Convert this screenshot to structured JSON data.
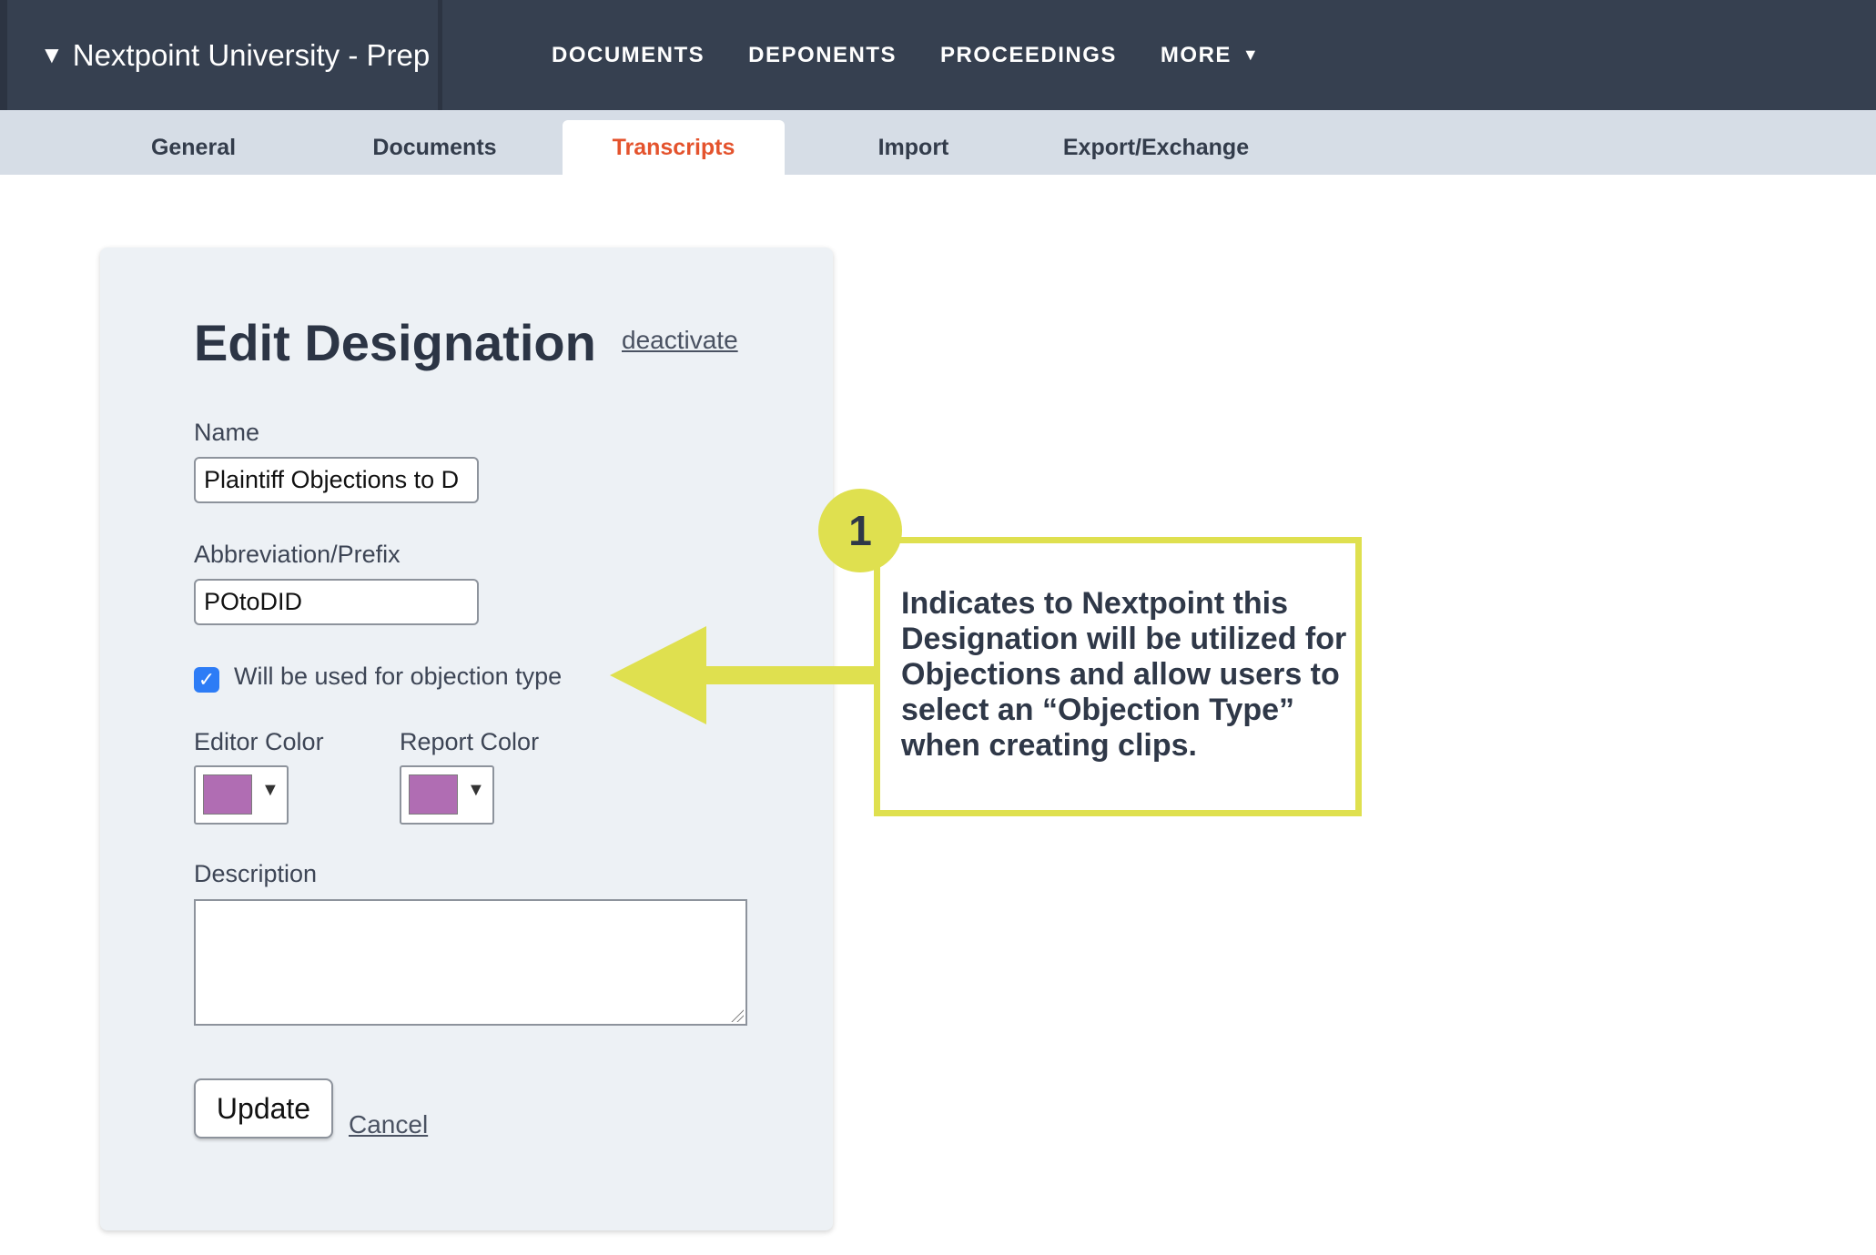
{
  "workspace": {
    "caret": "▼",
    "name": "Nextpoint University - Prep"
  },
  "topnav": {
    "items": [
      {
        "label": "DOCUMENTS"
      },
      {
        "label": "DEPONENTS"
      },
      {
        "label": "PROCEEDINGS"
      },
      {
        "label": "MORE",
        "caret": "▼"
      }
    ]
  },
  "tabs": [
    {
      "label": "General",
      "active": false
    },
    {
      "label": "Documents",
      "active": false
    },
    {
      "label": "Transcripts",
      "active": true
    },
    {
      "label": "Import",
      "active": false
    },
    {
      "label": "Export/Exchange",
      "active": false
    }
  ],
  "form": {
    "title": "Edit Designation",
    "deactivate_label": "deactivate",
    "name_label": "Name",
    "name_value": "Plaintiff Objections to D",
    "abbrev_label": "Abbreviation/Prefix",
    "abbrev_value": "POtoDID",
    "objection_checkbox_label": "Will be used for objection type",
    "objection_checked": true,
    "editor_color_label": "Editor Color",
    "report_color_label": "Report Color",
    "editor_color": "#b06db3",
    "report_color": "#b06db3",
    "description_label": "Description",
    "description_value": "",
    "update_label": "Update",
    "cancel_label": "Cancel"
  },
  "callout": {
    "number": "1",
    "text": "Indicates to Nextpoint this Designation will be utilized for Objections and allow users to select an “Objection Type” when creating clips.",
    "accent": "#dfe04f"
  },
  "colors": {
    "topbar": "#364050",
    "subbar": "#d6dde6",
    "active_tab": "#e4532d",
    "card": "#edf1f5",
    "checkbox": "#2d7cf6"
  }
}
